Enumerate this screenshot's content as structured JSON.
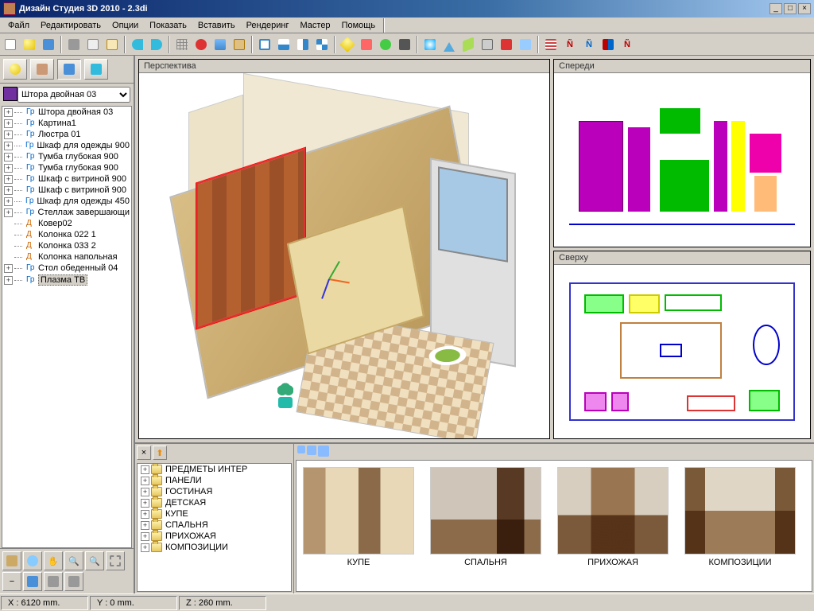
{
  "window": {
    "title": "Дизайн Студия 3D 2010 - 2.3di",
    "min_glyph": "_",
    "max_glyph": "□",
    "close_glyph": "×"
  },
  "menu": [
    "Файл",
    "Редактировать",
    "Опции",
    "Показать",
    "Вставить",
    "Рендеринг",
    "Мастер",
    "Помощь"
  ],
  "combo": {
    "selected": "Штора двойная 03"
  },
  "scene_tree": [
    {
      "label": "Штора двойная 03",
      "exp": "+",
      "kind": "g"
    },
    {
      "label": "Картина1",
      "exp": "+",
      "kind": "g"
    },
    {
      "label": "Люстра 01",
      "exp": "+",
      "kind": "g"
    },
    {
      "label": "Шкаф для одежды 900",
      "exp": "+",
      "kind": "g"
    },
    {
      "label": "Тумба глубокая 900",
      "exp": "+",
      "kind": "g"
    },
    {
      "label": "Тумба глубокая 900",
      "exp": "+",
      "kind": "g"
    },
    {
      "label": "Шкаф с витриной 900",
      "exp": "+",
      "kind": "g"
    },
    {
      "label": "Шкаф с витриной 900",
      "exp": "+",
      "kind": "g"
    },
    {
      "label": "Шкаф для одежды 450",
      "exp": "+",
      "kind": "g"
    },
    {
      "label": "Стеллаж завершающи",
      "exp": "+",
      "kind": "g"
    },
    {
      "label": "Ковер02",
      "exp": "",
      "kind": "d"
    },
    {
      "label": "Колонка 022 1",
      "exp": "",
      "kind": "d"
    },
    {
      "label": "Колонка 033 2",
      "exp": "",
      "kind": "d"
    },
    {
      "label": "Колонка напольная",
      "exp": "",
      "kind": "d"
    },
    {
      "label": "Стол обеденный 04",
      "exp": "+",
      "kind": "g"
    },
    {
      "label": "Плазма ТВ",
      "exp": "+",
      "kind": "g",
      "selected": true
    }
  ],
  "viewports": {
    "perspective": "Перспектива",
    "front": "Спереди",
    "top": "Сверху"
  },
  "library_tree": [
    "ПРЕДМЕТЫ ИНТЕР",
    "ПАНЕЛИ",
    "ГОСТИНАЯ",
    "ДЕТСКАЯ",
    "КУПЕ",
    "СПАЛЬНЯ",
    "ПРИХОЖАЯ",
    "КОМПОЗИЦИИ"
  ],
  "thumbs": [
    {
      "label": "КУПЕ"
    },
    {
      "label": "СПАЛЬНЯ"
    },
    {
      "label": "ПРИХОЖАЯ"
    },
    {
      "label": "КОМПОЗИЦИИ"
    }
  ],
  "status": {
    "x": "X : 6120 mm.",
    "y": "Y : 0 mm.",
    "z": "Z : 260 mm."
  }
}
